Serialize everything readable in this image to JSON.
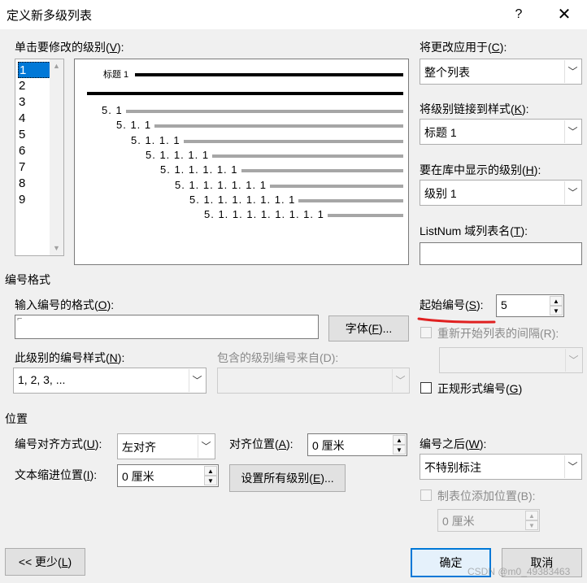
{
  "dialog": {
    "title": "定义新多级列表",
    "help_glyph": "?",
    "close_glyph": "✕"
  },
  "level_list": {
    "label_pre": "单击要修改的级别(",
    "label_key": "V",
    "label_post": "):",
    "items": [
      "1",
      "2",
      "3",
      "4",
      "5",
      "6",
      "7",
      "8",
      "9"
    ],
    "selected": "1"
  },
  "preview": {
    "heading_label": "标题 1",
    "numbers": [
      "5. 1",
      "5. 1. 1",
      "5. 1. 1. 1",
      "5. 1. 1. 1. 1",
      "5. 1. 1. 1. 1. 1",
      "5. 1. 1. 1. 1. 1. 1",
      "5. 1. 1. 1. 1. 1. 1. 1",
      "5. 1. 1. 1. 1. 1. 1. 1. 1"
    ]
  },
  "apply_to": {
    "label_pre": "将更改应用于(",
    "label_key": "C",
    "label_post": "):",
    "value": "整个列表"
  },
  "link_style": {
    "label_pre": "将级别链接到样式(",
    "label_key": "K",
    "label_post": "):",
    "value": "标题 1"
  },
  "gallery_level": {
    "label_pre": "要在库中显示的级别(",
    "label_key": "H",
    "label_post": "):",
    "value": "级别 1"
  },
  "listnum": {
    "label_pre": "ListNum 域列表名(",
    "label_key": "T",
    "label_post": "):",
    "value": ""
  },
  "number_format_section": {
    "title": "编号格式",
    "format_label_pre": "输入编号的格式(",
    "format_label_key": "O",
    "format_label_post": "):",
    "format_value": "",
    "font_button_pre": "字体(",
    "font_button_key": "F",
    "font_button_post": ")...",
    "style_label_pre": "此级别的编号样式(",
    "style_label_key": "N",
    "style_label_post": "):",
    "style_value": "1, 2, 3, ...",
    "include_label": "包含的级别编号来自(D):",
    "include_value": ""
  },
  "start_at": {
    "label_pre": "起始编号(",
    "label_key": "S",
    "label_post": "):",
    "value": "5",
    "annotation_color": "#e02020"
  },
  "restart": {
    "label": "重新开始列表的间隔(R):",
    "value": ""
  },
  "legal": {
    "label_pre": "正规形式编号(",
    "label_key": "G",
    "label_post": ")"
  },
  "position_section": {
    "title": "位置",
    "align_label_pre": "编号对齐方式(",
    "align_label_key": "U",
    "align_label_post": "):",
    "align_value": "左对齐",
    "align_at_label_pre": "对齐位置(",
    "align_at_label_key": "A",
    "align_at_label_post": "):",
    "align_at_value": "0 厘米",
    "indent_label_pre": "文本缩进位置(",
    "indent_label_key": "I",
    "indent_label_post": "):",
    "indent_value": "0 厘米",
    "set_all_pre": "设置所有级别(",
    "set_all_key": "E",
    "set_all_post": ")..."
  },
  "follow": {
    "label_pre": "编号之后(",
    "label_key": "W",
    "label_post": "):",
    "value": "不特别标注",
    "tab_label": "制表位添加位置(B):",
    "tab_value": "0 厘米"
  },
  "footer": {
    "less_pre": "<< 更少(",
    "less_key": "L",
    "less_post": ")",
    "ok": "确定",
    "cancel": "取消",
    "watermark": "CSDN @m0_49383463"
  },
  "colors": {
    "accent": "#0078d7",
    "face": "#f0f0f0"
  }
}
